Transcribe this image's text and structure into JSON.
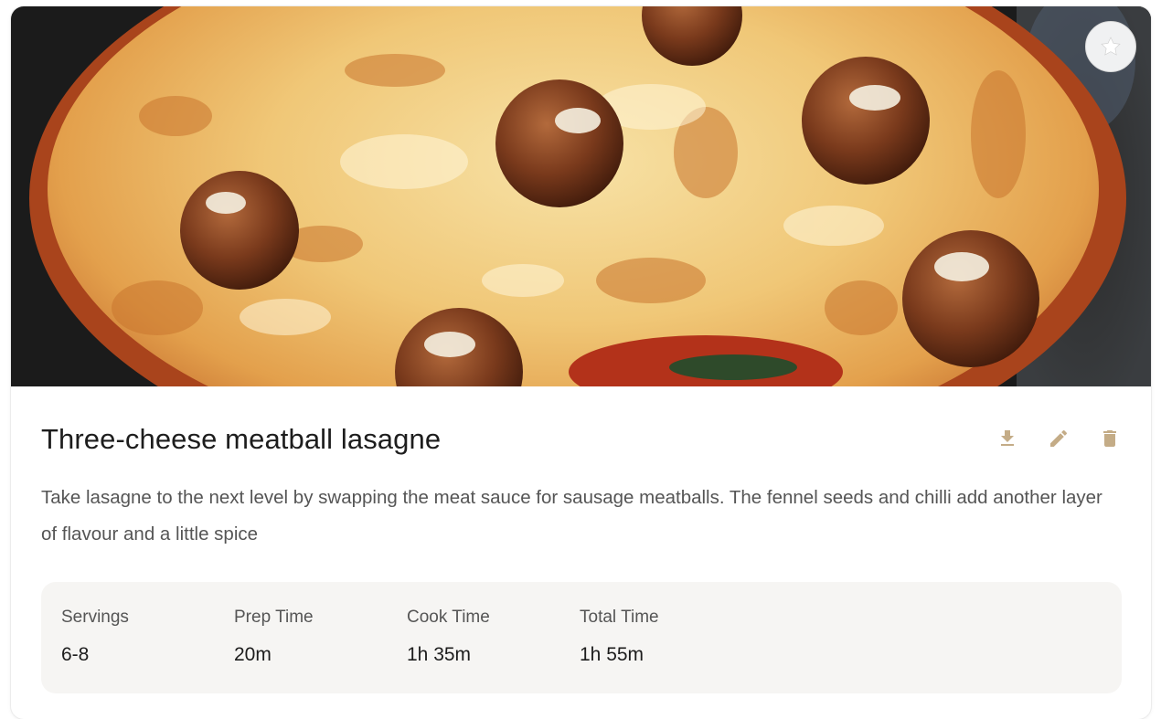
{
  "recipe": {
    "title": "Three-cheese meatball lasagne",
    "description": "Take lasagne to the next level by swapping the meat sauce for sausage meatballs. The fennel seeds and chilli add another layer of flavour and a little spice",
    "image": {
      "alt": "Three-cheese meatball lasagne photo"
    }
  },
  "actions": {
    "favorite": "star-icon",
    "download": "download-icon",
    "edit": "pencil-icon",
    "delete": "trash-icon"
  },
  "stats": [
    {
      "label": "Servings",
      "value": "6-8"
    },
    {
      "label": "Prep Time",
      "value": "20m"
    },
    {
      "label": "Cook Time",
      "value": "1h 35m"
    },
    {
      "label": "Total Time",
      "value": "1h 55m"
    }
  ],
  "colors": {
    "accent": "#c4ac87",
    "stats_background": "#f6f5f3",
    "title": "#1d1d1d",
    "body_text": "#555555"
  }
}
